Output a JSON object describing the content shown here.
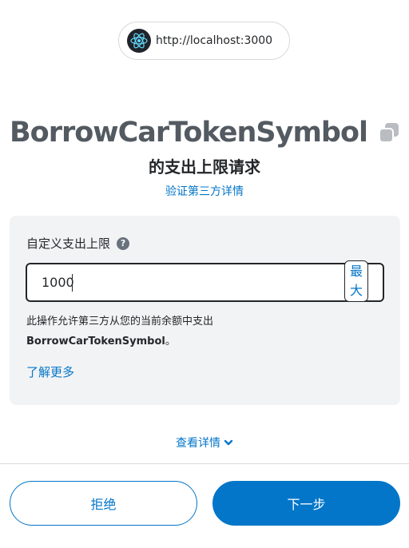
{
  "origin": {
    "url": "http://localhost:3000",
    "icon": "react-atom-icon"
  },
  "header": {
    "token_symbol": "BorrowCarTokenSymbol",
    "subtitle": "的支出上限请求",
    "verify_link": "验证第三方详情"
  },
  "spending_cap": {
    "label": "自定义支出上限",
    "help_icon_glyph": "?",
    "input_value": "1000",
    "max_label_line1": "最",
    "max_label_line2": "大",
    "description_prefix": "此操作允许第三方从您的当前余额中支出",
    "description_token": "BorrowCarTokenSymbol",
    "description_suffix": "。",
    "learn_more": "了解更多"
  },
  "details": {
    "view_details": "查看详情"
  },
  "footer": {
    "reject_label": "拒绝",
    "next_label": "下一步"
  },
  "colors": {
    "accent": "#0376c9",
    "title_gray": "#535a61",
    "card_bg": "#f2f3f4"
  }
}
